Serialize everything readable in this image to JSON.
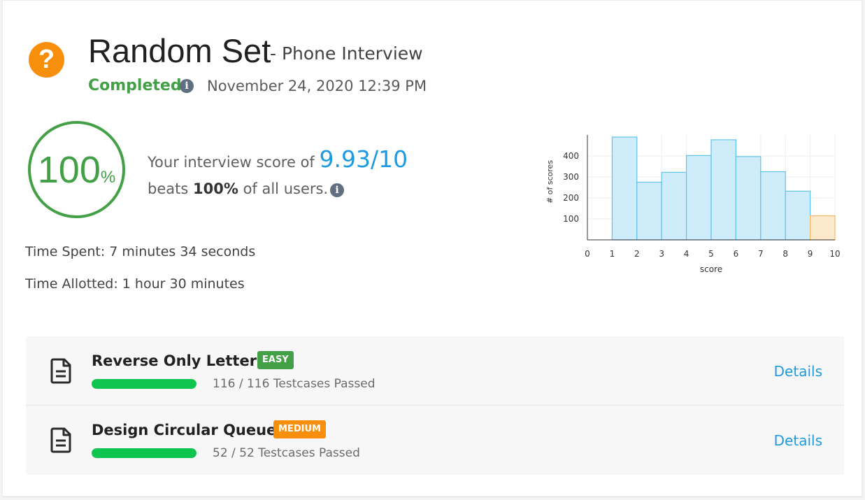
{
  "header": {
    "icon": "question-mark-icon",
    "title": "Random Set",
    "subtitle": "- Phone Interview",
    "status": "Completed",
    "date": "November 24, 2020 12:39 PM"
  },
  "score": {
    "percent_value": "100",
    "percent_symbol": "%",
    "prefix": "Your interview score of",
    "value": "9.93/10",
    "beats_prefix": "beats",
    "beats_value": "100%",
    "beats_suffix": "of all users.",
    "ring_color": "#43a047"
  },
  "time": {
    "spent": "Time Spent: 7 minutes 34 seconds",
    "allotted": "Time Allotted: 1 hour 30 minutes"
  },
  "chart_data": {
    "type": "bar",
    "xlabel": "score",
    "ylabel": "# of scores",
    "x_ticks": [
      "0",
      "1",
      "2",
      "3",
      "4",
      "5",
      "6",
      "7",
      "8",
      "9",
      "10"
    ],
    "y_ticks": [
      "100",
      "200",
      "300",
      "400"
    ],
    "xlim": [
      0,
      10
    ],
    "ylim": [
      0,
      500
    ],
    "bins": [
      [
        0,
        1
      ],
      [
        1,
        2
      ],
      [
        2,
        3
      ],
      [
        3,
        4
      ],
      [
        4,
        5
      ],
      [
        5,
        6
      ],
      [
        6,
        7
      ],
      [
        7,
        8
      ],
      [
        8,
        9
      ],
      [
        9,
        10
      ]
    ],
    "values": [
      0,
      490,
      275,
      322,
      402,
      477,
      397,
      325,
      232,
      115
    ],
    "highlight_bin": 9,
    "colors": {
      "bar_fill": "#cfecfb",
      "bar_stroke": "#5fc3ec",
      "highlight_fill": "#fde9cc",
      "highlight_stroke": "#f5b865"
    },
    "grid": true
  },
  "problems": [
    {
      "title": "Reverse Only Letters",
      "difficulty": "EASY",
      "testcases": "116 / 116 Testcases Passed",
      "progress": 1.0,
      "details_label": "Details",
      "icon": "document-icon"
    },
    {
      "title": "Design Circular Queue",
      "difficulty": "MEDIUM",
      "testcases": "52 / 52 Testcases Passed",
      "progress": 1.0,
      "details_label": "Details",
      "icon": "document-icon"
    }
  ],
  "colors": {
    "accent_blue": "#1e9be0",
    "success_green": "#43a047",
    "warning_orange": "#f88f0c",
    "progress_green": "#0fc54f"
  }
}
